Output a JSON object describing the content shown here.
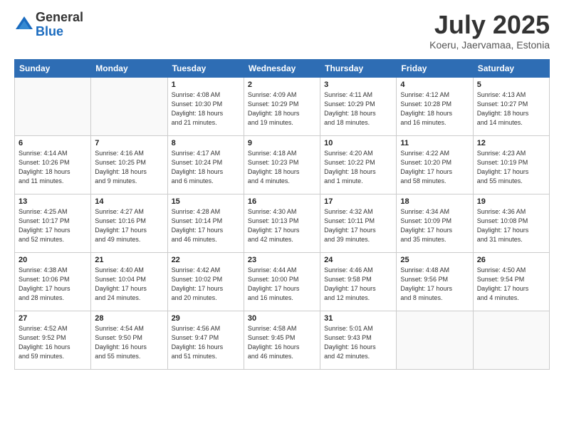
{
  "header": {
    "logo_general": "General",
    "logo_blue": "Blue",
    "month_title": "July 2025",
    "subtitle": "Koeru, Jaervamaa, Estonia"
  },
  "days_of_week": [
    "Sunday",
    "Monday",
    "Tuesday",
    "Wednesday",
    "Thursday",
    "Friday",
    "Saturday"
  ],
  "weeks": [
    [
      {
        "day": "",
        "detail": ""
      },
      {
        "day": "",
        "detail": ""
      },
      {
        "day": "1",
        "detail": "Sunrise: 4:08 AM\nSunset: 10:30 PM\nDaylight: 18 hours\nand 21 minutes."
      },
      {
        "day": "2",
        "detail": "Sunrise: 4:09 AM\nSunset: 10:29 PM\nDaylight: 18 hours\nand 19 minutes."
      },
      {
        "day": "3",
        "detail": "Sunrise: 4:11 AM\nSunset: 10:29 PM\nDaylight: 18 hours\nand 18 minutes."
      },
      {
        "day": "4",
        "detail": "Sunrise: 4:12 AM\nSunset: 10:28 PM\nDaylight: 18 hours\nand 16 minutes."
      },
      {
        "day": "5",
        "detail": "Sunrise: 4:13 AM\nSunset: 10:27 PM\nDaylight: 18 hours\nand 14 minutes."
      }
    ],
    [
      {
        "day": "6",
        "detail": "Sunrise: 4:14 AM\nSunset: 10:26 PM\nDaylight: 18 hours\nand 11 minutes."
      },
      {
        "day": "7",
        "detail": "Sunrise: 4:16 AM\nSunset: 10:25 PM\nDaylight: 18 hours\nand 9 minutes."
      },
      {
        "day": "8",
        "detail": "Sunrise: 4:17 AM\nSunset: 10:24 PM\nDaylight: 18 hours\nand 6 minutes."
      },
      {
        "day": "9",
        "detail": "Sunrise: 4:18 AM\nSunset: 10:23 PM\nDaylight: 18 hours\nand 4 minutes."
      },
      {
        "day": "10",
        "detail": "Sunrise: 4:20 AM\nSunset: 10:22 PM\nDaylight: 18 hours\nand 1 minute."
      },
      {
        "day": "11",
        "detail": "Sunrise: 4:22 AM\nSunset: 10:20 PM\nDaylight: 17 hours\nand 58 minutes."
      },
      {
        "day": "12",
        "detail": "Sunrise: 4:23 AM\nSunset: 10:19 PM\nDaylight: 17 hours\nand 55 minutes."
      }
    ],
    [
      {
        "day": "13",
        "detail": "Sunrise: 4:25 AM\nSunset: 10:17 PM\nDaylight: 17 hours\nand 52 minutes."
      },
      {
        "day": "14",
        "detail": "Sunrise: 4:27 AM\nSunset: 10:16 PM\nDaylight: 17 hours\nand 49 minutes."
      },
      {
        "day": "15",
        "detail": "Sunrise: 4:28 AM\nSunset: 10:14 PM\nDaylight: 17 hours\nand 46 minutes."
      },
      {
        "day": "16",
        "detail": "Sunrise: 4:30 AM\nSunset: 10:13 PM\nDaylight: 17 hours\nand 42 minutes."
      },
      {
        "day": "17",
        "detail": "Sunrise: 4:32 AM\nSunset: 10:11 PM\nDaylight: 17 hours\nand 39 minutes."
      },
      {
        "day": "18",
        "detail": "Sunrise: 4:34 AM\nSunset: 10:09 PM\nDaylight: 17 hours\nand 35 minutes."
      },
      {
        "day": "19",
        "detail": "Sunrise: 4:36 AM\nSunset: 10:08 PM\nDaylight: 17 hours\nand 31 minutes."
      }
    ],
    [
      {
        "day": "20",
        "detail": "Sunrise: 4:38 AM\nSunset: 10:06 PM\nDaylight: 17 hours\nand 28 minutes."
      },
      {
        "day": "21",
        "detail": "Sunrise: 4:40 AM\nSunset: 10:04 PM\nDaylight: 17 hours\nand 24 minutes."
      },
      {
        "day": "22",
        "detail": "Sunrise: 4:42 AM\nSunset: 10:02 PM\nDaylight: 17 hours\nand 20 minutes."
      },
      {
        "day": "23",
        "detail": "Sunrise: 4:44 AM\nSunset: 10:00 PM\nDaylight: 17 hours\nand 16 minutes."
      },
      {
        "day": "24",
        "detail": "Sunrise: 4:46 AM\nSunset: 9:58 PM\nDaylight: 17 hours\nand 12 minutes."
      },
      {
        "day": "25",
        "detail": "Sunrise: 4:48 AM\nSunset: 9:56 PM\nDaylight: 17 hours\nand 8 minutes."
      },
      {
        "day": "26",
        "detail": "Sunrise: 4:50 AM\nSunset: 9:54 PM\nDaylight: 17 hours\nand 4 minutes."
      }
    ],
    [
      {
        "day": "27",
        "detail": "Sunrise: 4:52 AM\nSunset: 9:52 PM\nDaylight: 16 hours\nand 59 minutes."
      },
      {
        "day": "28",
        "detail": "Sunrise: 4:54 AM\nSunset: 9:50 PM\nDaylight: 16 hours\nand 55 minutes."
      },
      {
        "day": "29",
        "detail": "Sunrise: 4:56 AM\nSunset: 9:47 PM\nDaylight: 16 hours\nand 51 minutes."
      },
      {
        "day": "30",
        "detail": "Sunrise: 4:58 AM\nSunset: 9:45 PM\nDaylight: 16 hours\nand 46 minutes."
      },
      {
        "day": "31",
        "detail": "Sunrise: 5:01 AM\nSunset: 9:43 PM\nDaylight: 16 hours\nand 42 minutes."
      },
      {
        "day": "",
        "detail": ""
      },
      {
        "day": "",
        "detail": ""
      }
    ]
  ]
}
